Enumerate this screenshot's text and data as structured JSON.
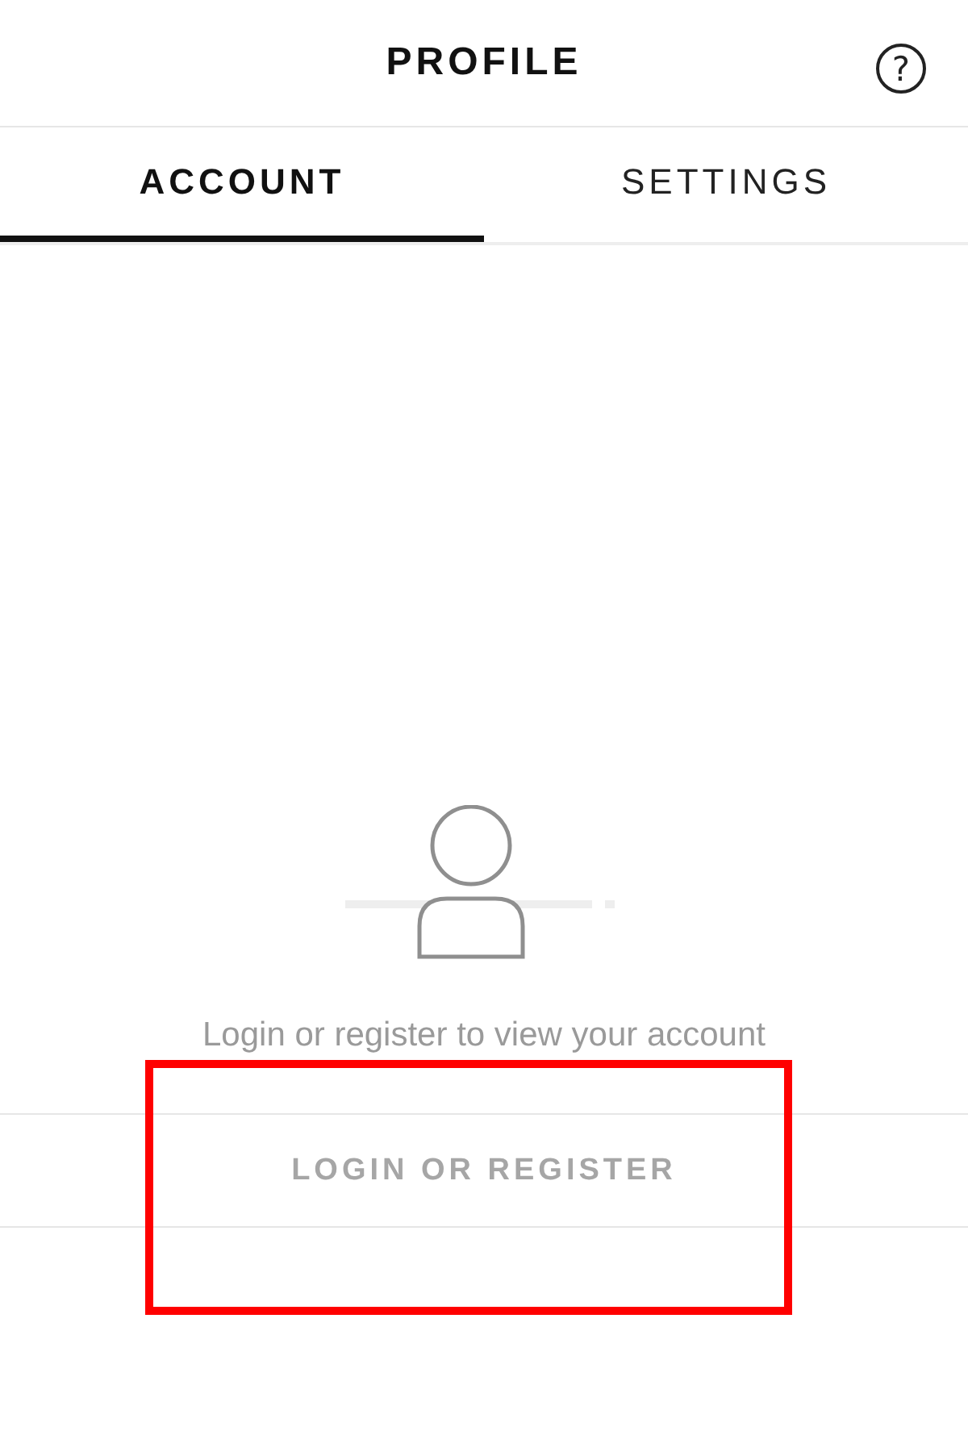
{
  "header": {
    "title": "PROFILE",
    "help": "?"
  },
  "tabs": [
    {
      "label": "ACCOUNT",
      "selected": true
    },
    {
      "label": "SETTINGS",
      "selected": false
    }
  ],
  "empty_state": {
    "message": "Login or register to view your account"
  },
  "login_button": {
    "label": "LOGIN OR REGISTER",
    "highlighted": true
  }
}
